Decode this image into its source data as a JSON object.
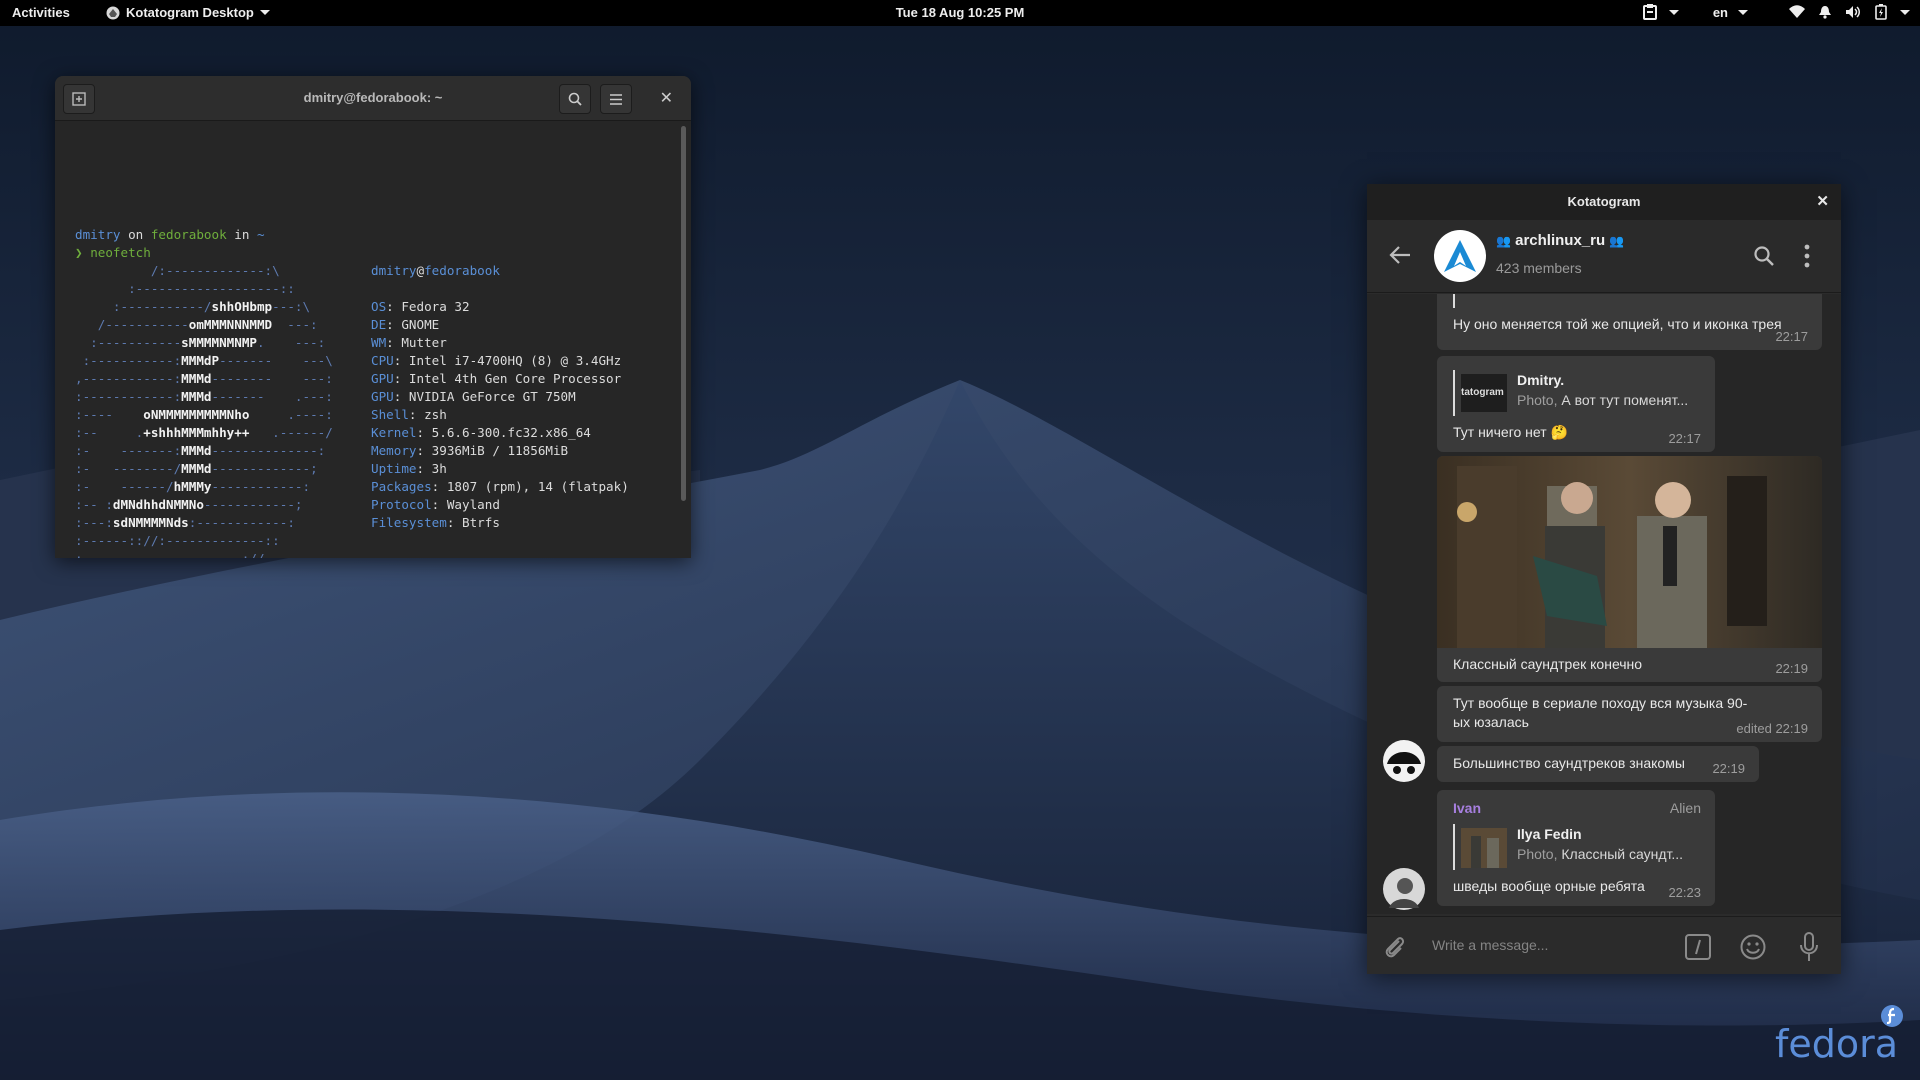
{
  "topbar": {
    "activities": "Activities",
    "app_menu": "Kotatogram Desktop",
    "clock": "Tue 18 Aug  10:25 PM",
    "language": "en"
  },
  "terminal": {
    "title": "dmitry@fedorabook: ~",
    "prompt_user": "dmitry",
    "prompt_on": " on ",
    "prompt_host": "fedorabook",
    "prompt_in": " in ",
    "prompt_dir": "~",
    "prompt_arrow": "❯",
    "command": "neofetch",
    "logo": [
      "          /:-------------:\\",
      "       :-------------------::",
      "     :-----------/shhOHbmp---:\\",
      "   /-----------omMMMNNNMMD  ---:",
      "  :-----------sMMMMNMNMP.    ---:",
      " :-----------:MMMdP-------    ---\\",
      ",------------:MMMd--------    ---:",
      ":------------:MMMd-------    .---:",
      ":----    oNMMMMMMMMMNho     .----:",
      ":--     .+shhhMMMmhhy++   .------/",
      ":-    -------:MMMd--------------:",
      ":-   --------/MMMd-------------;",
      ":-    ------/hMMMy------------:",
      ":-- :dMNdhhdNMMNo------------;",
      ":---:sdNMMMMNds:------------:",
      ":------:://:-------------::",
      ":---------------------://"
    ],
    "info_user": "dmitry",
    "info_at": "@",
    "info_host": "fedorabook",
    "info": [
      {
        "key": "OS",
        "value": ": Fedora 32"
      },
      {
        "key": "DE",
        "value": ": GNOME"
      },
      {
        "key": "WM",
        "value": ": Mutter"
      },
      {
        "key": "CPU",
        "value": ": Intel i7-4700HQ (8) @ 3.4GHz"
      },
      {
        "key": "GPU",
        "value": ": Intel 4th Gen Core Processor"
      },
      {
        "key": "GPU",
        "value": ": NVIDIA GeForce GT 750M"
      },
      {
        "key": "Shell",
        "value": ": zsh"
      },
      {
        "key": "Kernel",
        "value": ": 5.6.6-300.fc32.x86_64"
      },
      {
        "key": "Memory",
        "value": ": 3936MiB / 11856MiB"
      },
      {
        "key": "Uptime",
        "value": ": 3h"
      },
      {
        "key": "Packages",
        "value": ": 1807 (rpm), 14 (flatpak)"
      },
      {
        "key": "Protocol",
        "value": ": Wayland"
      },
      {
        "key": "Filesystem",
        "value": ": Btrfs"
      }
    ],
    "palette": [
      "#2b2b2b",
      "#cc1010",
      "#3aa02a",
      "#c8a000",
      "#3a6fb8",
      "#7a4f98",
      "#159a9a",
      "#dedede"
    ]
  },
  "kotato": {
    "window_title": "Kotatogram",
    "chat_name": "archlinux_ru",
    "members": "423 members",
    "messages": [
      {
        "text": "Ну оно меняется той же опцией, что и иконка трея",
        "time": "22:17"
      },
      {
        "reply_name": "Dmitry.",
        "reply_thumb": "tatogram",
        "reply_prefix": "Photo, ",
        "reply_text": "А вот тут поменят...",
        "text": "Тут ничего нет 🤔",
        "time": "22:17"
      },
      {
        "text": "Классный саундтрек конечно",
        "time": "22:19"
      },
      {
        "text": "Тут вообще в сериале походу вся музыка 90-ых юзалась",
        "time": "edited 22:19"
      },
      {
        "text": "Большинство саундтреков знакомы",
        "time": "22:19"
      },
      {
        "sender": "Ivan",
        "badge": "Alien",
        "reply_name": "Ilya Fedin",
        "reply_prefix": "Photo, ",
        "reply_text": "Классный саундт...",
        "text": "шведы вообще орные ребята",
        "time": "22:23"
      }
    ],
    "composer_placeholder": "Write a message..."
  },
  "desktop": {
    "logo_text": "fedora"
  }
}
